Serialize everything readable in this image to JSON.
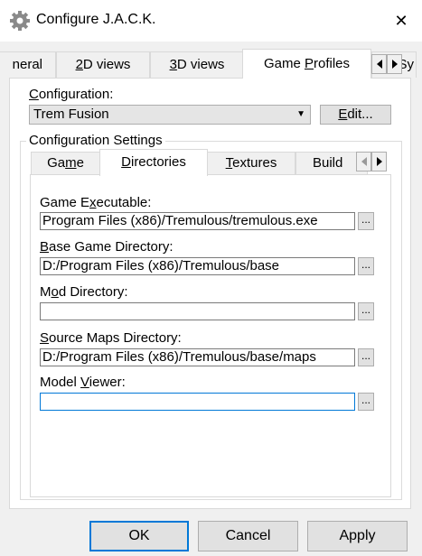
{
  "window": {
    "title": "Configure J.A.C.K.",
    "icon": "gear-icon",
    "close_glyph": "✕"
  },
  "outer_tabs": [
    {
      "label": "neral"
    },
    {
      "label_pre": "",
      "label_u": "2",
      "label_post": "D views"
    },
    {
      "label_pre": "",
      "label_u": "3",
      "label_post": "D views"
    },
    {
      "label_pre": "Game ",
      "label_u": "P",
      "label_post": "rofiles"
    },
    {
      "label": "Sy"
    }
  ],
  "configuration": {
    "label_pre": "",
    "label_u": "C",
    "label_post": "onfiguration:",
    "selected": "Trem Fusion",
    "edit_button_pre": "",
    "edit_button_u": "E",
    "edit_button_post": "dit..."
  },
  "settings_group": {
    "label": "Configuration Settings",
    "tabs": [
      {
        "label_pre": "Ga",
        "label_u": "m",
        "label_post": "e"
      },
      {
        "label_pre": "",
        "label_u": "D",
        "label_post": "irectories"
      },
      {
        "label_pre": "",
        "label_u": "T",
        "label_post": "extures"
      },
      {
        "label_pre": "Build",
        "label_u": "",
        "label_post": ""
      }
    ]
  },
  "fields": [
    {
      "label_pre": "Game E",
      "label_u": "x",
      "label_post": "ecutable:",
      "value": "Program Files (x86)/Tremulous/tremulous.exe",
      "browse": "..."
    },
    {
      "label_pre": "",
      "label_u": "B",
      "label_post": "ase Game Directory:",
      "value": "D:/Program Files (x86)/Tremulous/base",
      "browse": "..."
    },
    {
      "label_pre": "M",
      "label_u": "o",
      "label_post": "d Directory:",
      "value": "",
      "browse": "..."
    },
    {
      "label_pre": "",
      "label_u": "S",
      "label_post": "ource Maps Directory:",
      "value": "D:/Program Files (x86)/Tremulous/base/maps",
      "browse": "..."
    },
    {
      "label_pre": "Model ",
      "label_u": "V",
      "label_post": "iewer:",
      "value": "",
      "browse": "..."
    }
  ],
  "buttons": {
    "ok": "OK",
    "cancel": "Cancel",
    "apply": "Apply"
  },
  "colors": {
    "focus_border": "#0078d7",
    "button_face": "#e1e1e1",
    "window_bg": "#f0f0f0"
  }
}
